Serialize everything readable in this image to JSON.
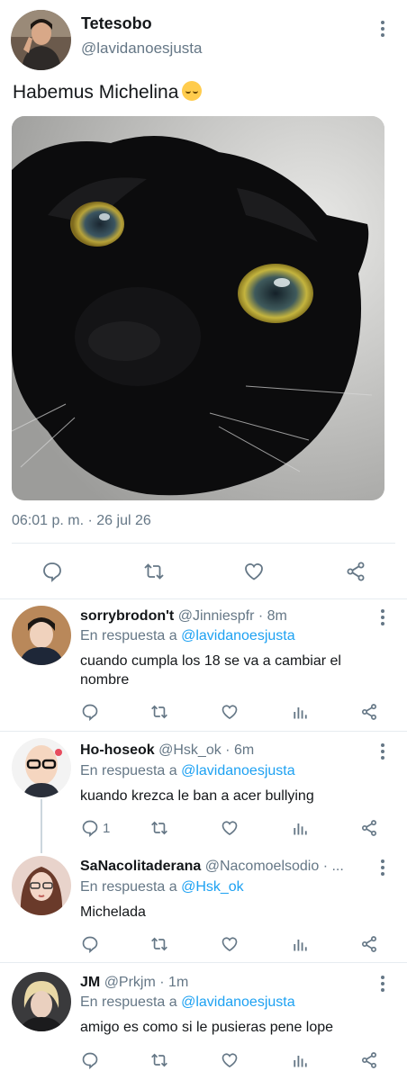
{
  "main_tweet": {
    "author_name": "Tetesobo",
    "author_handle": "@lavidanoesjusta",
    "text": "Habemus Michelina",
    "emoji_icon": "relieved-face-emoji",
    "timestamp": "06:01 p. m. · 26 jul 26",
    "actions": [
      "reply-icon",
      "retweet-icon",
      "like-icon",
      "share-icon"
    ]
  },
  "replies": [
    {
      "name": "sorrybrodon't",
      "handle": "@Jinniespfr",
      "time": "· 8m",
      "reply_prefix": "En respuesta a",
      "reply_to": "@lavidanoesjusta",
      "text": "cuando cumpla los 18 se va a cambiar el nombre",
      "reply_count": ""
    },
    {
      "name": "Ho-hoseok",
      "handle": "@Hsk_ok",
      "time": "· 6m",
      "reply_prefix": "En respuesta a",
      "reply_to": "@lavidanoesjusta",
      "text": "kuando krezca le ban a acer bullying",
      "reply_count": "1"
    },
    {
      "name": "SaNacolitaderana",
      "handle": "@Nacomoelsodio · ...",
      "time": "",
      "reply_prefix": "En respuesta a",
      "reply_to": "@Hsk_ok",
      "text": "Michelada",
      "reply_count": ""
    },
    {
      "name": "JM",
      "handle": "@Prkjm",
      "time": "· 1m",
      "reply_prefix": "En respuesta a",
      "reply_to": "@lavidanoesjusta",
      "text": "amigo es como si le pusieras pene lope",
      "reply_count": ""
    }
  ],
  "colors": {
    "accent": "#1da1f2",
    "secondary_text": "#657786",
    "divider": "#e6ecf0"
  }
}
